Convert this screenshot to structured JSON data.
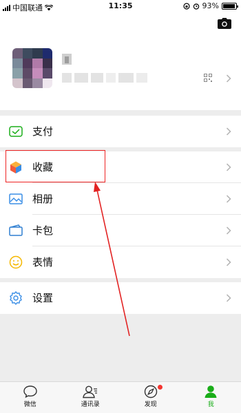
{
  "status_bar": {
    "carrier": "中国联通",
    "time": "11:35",
    "battery": "93%",
    "battery_level": 0.93
  },
  "profile": {
    "camera_icon": "camera-icon",
    "qr_icon": "qrcode-icon"
  },
  "menu": [
    {
      "label": "支付",
      "icon": "pay-icon"
    },
    {
      "label": "收藏",
      "icon": "favorites-icon"
    },
    {
      "label": "相册",
      "icon": "album-icon"
    },
    {
      "label": "卡包",
      "icon": "card-wallet-icon"
    },
    {
      "label": "表情",
      "icon": "emoji-icon"
    },
    {
      "label": "设置",
      "icon": "settings-icon"
    }
  ],
  "tabbar": [
    {
      "label": "微信",
      "icon": "chats-icon"
    },
    {
      "label": "通讯录",
      "icon": "contacts-icon"
    },
    {
      "label": "发现",
      "icon": "discover-icon",
      "badge": true
    },
    {
      "label": "我",
      "icon": "me-icon",
      "active": true
    }
  ],
  "colors": {
    "accent_green": "#1aad19",
    "annotation_red": "#e22222",
    "badge_red": "#f43530"
  }
}
